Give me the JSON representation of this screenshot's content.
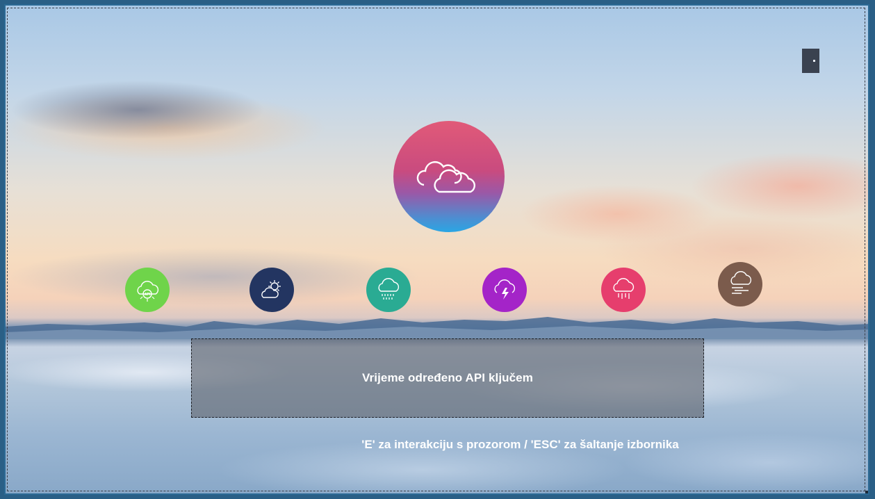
{
  "window": {
    "exit_icon": "door-icon"
  },
  "main_icon": {
    "name": "clouds-icon",
    "gradient": [
      "#e15a78",
      "#c94b7f",
      "#2aa6e4"
    ]
  },
  "options": [
    {
      "id": "api-weather",
      "icon": "cloud-sun-api-icon",
      "color": "#6fd44a"
    },
    {
      "id": "sunny",
      "icon": "sun-cloud-icon",
      "color": "#233561"
    },
    {
      "id": "rain",
      "icon": "rain-cloud-icon",
      "color": "#2aab93"
    },
    {
      "id": "storm",
      "icon": "lightning-cloud-icon",
      "color": "#a424c8"
    },
    {
      "id": "drizzle",
      "icon": "drizzle-cloud-icon",
      "color": "#e63e6d"
    },
    {
      "id": "fog",
      "icon": "fog-cloud-icon",
      "color": "#7b5b4c"
    }
  ],
  "info": {
    "text": "Vrijeme određeno API ključem"
  },
  "hint": {
    "text": "'E' za interakciju s prozorom / 'ESC' za šaltanje izbornika"
  }
}
